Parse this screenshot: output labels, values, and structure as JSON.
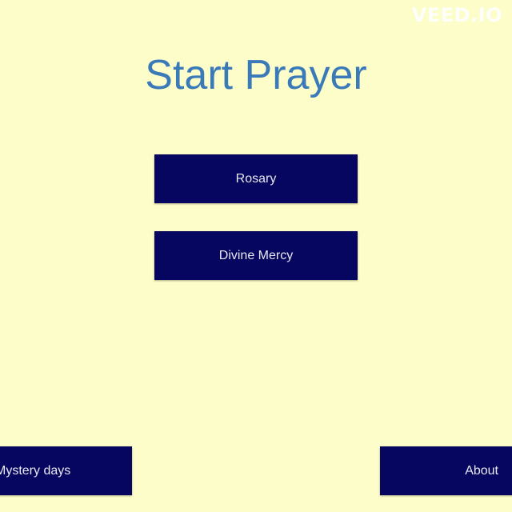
{
  "watermark": "VEED.IO",
  "title": "Start Prayer",
  "buttons": {
    "rosary": "Rosary",
    "divine_mercy": "Divine Mercy",
    "mystery_days": "Mystery days",
    "about": "About"
  },
  "colors": {
    "background": "#fdfdca",
    "title": "#3a7ab8",
    "button_bg": "#060660",
    "button_text": "#e8e8f0"
  }
}
